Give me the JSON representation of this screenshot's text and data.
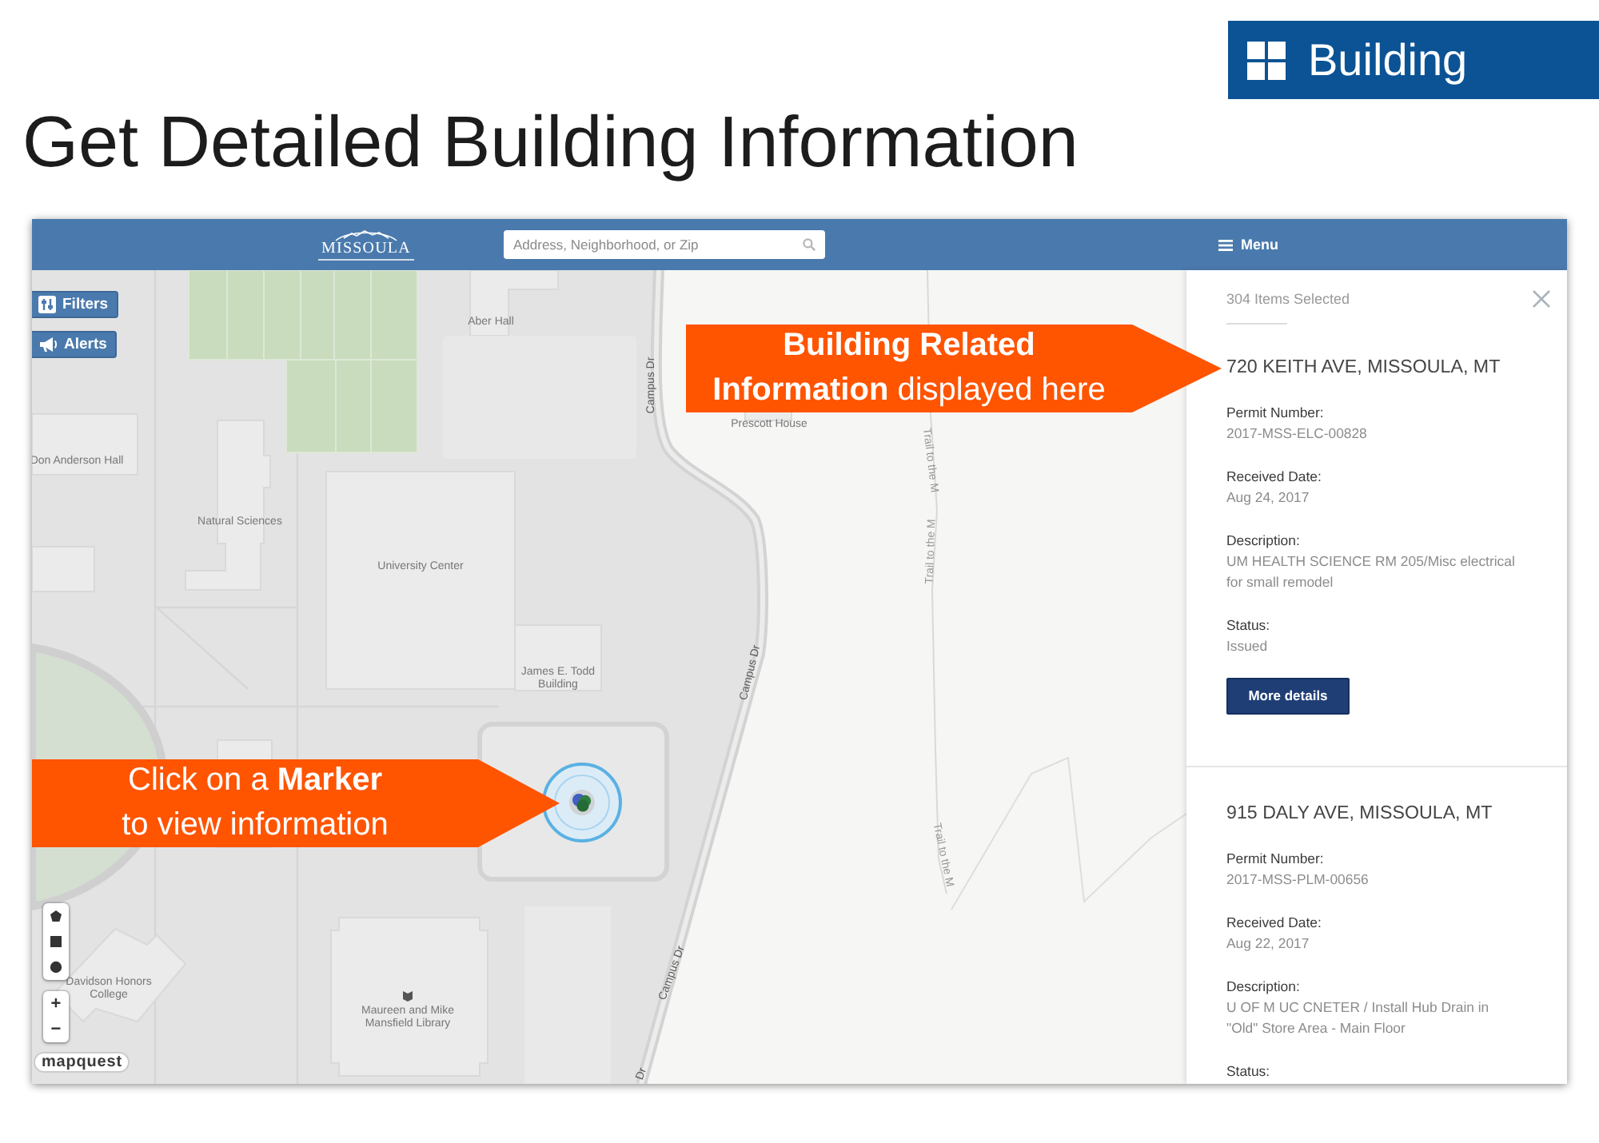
{
  "slide": {
    "badge": {
      "label": "Building"
    },
    "title": "Get Detailed Building Information"
  },
  "app": {
    "header": {
      "logo_text": "MISSOULA",
      "search": {
        "placeholder": "Address, Neighborhood, or Zip"
      },
      "menu_label": "Menu"
    },
    "map": {
      "buttons": [
        {
          "label": "Filters",
          "kind": "filters"
        },
        {
          "label": "Alerts",
          "kind": "alerts"
        }
      ],
      "labels": [
        {
          "text": "Aber Hall",
          "kind": "building"
        },
        {
          "text": "Don Anderson Hall",
          "kind": "building"
        },
        {
          "text": "Natural Sciences",
          "kind": "building"
        },
        {
          "text": "University Center",
          "kind": "building"
        },
        {
          "text": "James E. Todd Building",
          "kind": "building"
        },
        {
          "text": "Prescott House",
          "kind": "building"
        },
        {
          "text": "Campus Dr",
          "kind": "street"
        },
        {
          "text": "Trail to the M",
          "kind": "trail"
        },
        {
          "text": "Trail to the M",
          "kind": "trail"
        },
        {
          "text": "Campus Dr",
          "kind": "street"
        },
        {
          "text": "Trail to the M",
          "kind": "trail"
        },
        {
          "text": "Davidson Honors College",
          "kind": "building"
        },
        {
          "text": "Maureen and Mike Mansfield Library",
          "kind": "building"
        },
        {
          "text": "Campus Dr",
          "kind": "street"
        },
        {
          "text": "Dr",
          "kind": "street"
        }
      ],
      "zoom_in": "+",
      "zoom_out": "−",
      "attribution": "mapquest"
    },
    "panel": {
      "selection_count": "304 Items Selected",
      "records": [
        {
          "address": "720 KEITH AVE, MISSOULA, MT",
          "fields": [
            {
              "label": "Permit Number:",
              "value": "2017-MSS-ELC-00828"
            },
            {
              "label": "Received Date:",
              "value": "Aug 24, 2017"
            },
            {
              "label": "Description:",
              "value": "UM HEALTH SCIENCE RM 205/Misc electrical for small remodel"
            },
            {
              "label": "Status:",
              "value": "Issued"
            }
          ],
          "button": "More details"
        },
        {
          "address": "915 DALY AVE, MISSOULA, MT",
          "fields": [
            {
              "label": "Permit Number:",
              "value": "2017-MSS-PLM-00656"
            },
            {
              "label": "Received Date:",
              "value": "Aug 22, 2017"
            },
            {
              "label": "Description:",
              "value": "U OF M UC CNETER / Install Hub Drain in \"Old\" Store Area - Main Floor"
            },
            {
              "label": "Status:"
            }
          ]
        }
      ]
    }
  },
  "callouts": [
    {
      "text": "**Building Related**\n**Information** displayed here"
    },
    {
      "text": "Click on a **Marker**\nto view information"
    }
  ]
}
